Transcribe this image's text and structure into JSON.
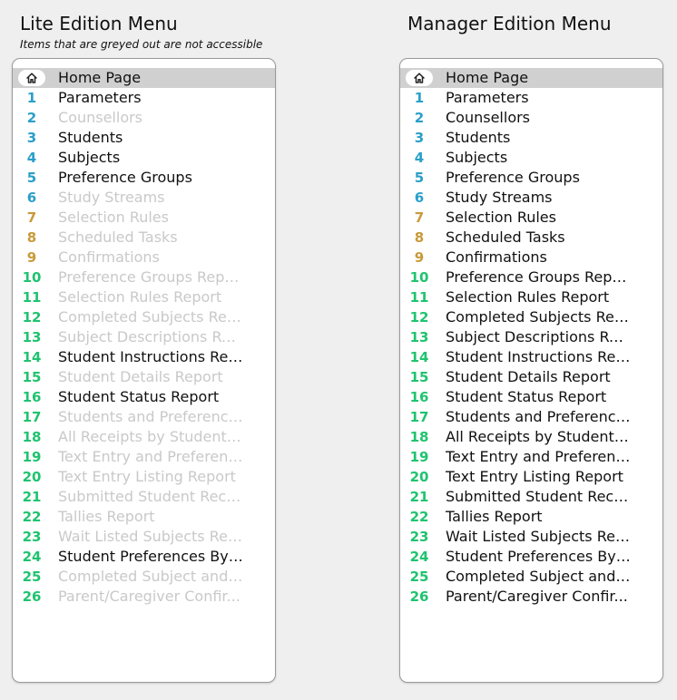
{
  "lite": {
    "title": "Lite Edition Menu",
    "subtitle": "Items that are greyed out are not accessible",
    "home_label": "Home Page",
    "items": [
      {
        "num": "1",
        "label": "Parameters",
        "color": "#2a9fc9",
        "enabled": true
      },
      {
        "num": "2",
        "label": "Counsellors",
        "color": "#2a9fc9",
        "enabled": false
      },
      {
        "num": "3",
        "label": "Students",
        "color": "#2a9fc9",
        "enabled": true
      },
      {
        "num": "4",
        "label": "Subjects",
        "color": "#2a9fc9",
        "enabled": true
      },
      {
        "num": "5",
        "label": "Preference Groups",
        "color": "#2a9fc9",
        "enabled": true
      },
      {
        "num": "6",
        "label": "Study Streams",
        "color": "#2a9fc9",
        "enabled": false
      },
      {
        "num": "7",
        "label": "Selection Rules",
        "color": "#c99a3a",
        "enabled": false
      },
      {
        "num": "8",
        "label": "Scheduled Tasks",
        "color": "#c99a3a",
        "enabled": false
      },
      {
        "num": "9",
        "label": "Confirmations",
        "color": "#c99a3a",
        "enabled": false
      },
      {
        "num": "10",
        "label": "Preference Groups Report",
        "color": "#1fc36f",
        "enabled": false
      },
      {
        "num": "11",
        "label": "Selection Rules Report",
        "color": "#1fc36f",
        "enabled": false
      },
      {
        "num": "12",
        "label": "Completed Subjects Rep...",
        "color": "#1fc36f",
        "enabled": false
      },
      {
        "num": "13",
        "label": "Subject Descriptions Rep...",
        "color": "#1fc36f",
        "enabled": false
      },
      {
        "num": "14",
        "label": "Student Instructions Rep...",
        "color": "#1fc36f",
        "enabled": true
      },
      {
        "num": "15",
        "label": "Student Details Report",
        "color": "#1fc36f",
        "enabled": false
      },
      {
        "num": "16",
        "label": "Student Status Report",
        "color": "#1fc36f",
        "enabled": true
      },
      {
        "num": "17",
        "label": "Students and Preference...",
        "color": "#1fc36f",
        "enabled": false
      },
      {
        "num": "18",
        "label": "All Receipts by Student R...",
        "color": "#1fc36f",
        "enabled": false
      },
      {
        "num": "19",
        "label": "Text Entry and Preferenc...",
        "color": "#1fc36f",
        "enabled": false
      },
      {
        "num": "20",
        "label": "Text Entry Listing Report",
        "color": "#1fc36f",
        "enabled": false
      },
      {
        "num": "21",
        "label": "Submitted Student Recei...",
        "color": "#1fc36f",
        "enabled": false
      },
      {
        "num": "22",
        "label": "Tallies Report",
        "color": "#1fc36f",
        "enabled": false
      },
      {
        "num": "23",
        "label": "Wait Listed Subjects Rep...",
        "color": "#1fc36f",
        "enabled": false
      },
      {
        "num": "24",
        "label": "Student Preferences By S...",
        "color": "#1fc36f",
        "enabled": true
      },
      {
        "num": "25",
        "label": "Completed Subject and P...",
        "color": "#1fc36f",
        "enabled": false
      },
      {
        "num": "26",
        "label": "Parent/Caregiver Confir...",
        "color": "#1fc36f",
        "enabled": false
      }
    ]
  },
  "manager": {
    "title": "Manager Edition Menu",
    "home_label": "Home Page",
    "items": [
      {
        "num": "1",
        "label": "Parameters",
        "color": "#2a9fc9",
        "enabled": true
      },
      {
        "num": "2",
        "label": "Counsellors",
        "color": "#2a9fc9",
        "enabled": true
      },
      {
        "num": "3",
        "label": "Students",
        "color": "#2a9fc9",
        "enabled": true
      },
      {
        "num": "4",
        "label": "Subjects",
        "color": "#2a9fc9",
        "enabled": true
      },
      {
        "num": "5",
        "label": "Preference Groups",
        "color": "#2a9fc9",
        "enabled": true
      },
      {
        "num": "6",
        "label": "Study Streams",
        "color": "#2a9fc9",
        "enabled": true
      },
      {
        "num": "7",
        "label": "Selection Rules",
        "color": "#c99a3a",
        "enabled": true
      },
      {
        "num": "8",
        "label": "Scheduled Tasks",
        "color": "#c99a3a",
        "enabled": true
      },
      {
        "num": "9",
        "label": "Confirmations",
        "color": "#c99a3a",
        "enabled": true
      },
      {
        "num": "10",
        "label": "Preference Groups Report",
        "color": "#1fc36f",
        "enabled": true
      },
      {
        "num": "11",
        "label": "Selection Rules Report",
        "color": "#1fc36f",
        "enabled": true
      },
      {
        "num": "12",
        "label": "Completed Subjects Rep...",
        "color": "#1fc36f",
        "enabled": true
      },
      {
        "num": "13",
        "label": "Subject Descriptions Rep...",
        "color": "#1fc36f",
        "enabled": true
      },
      {
        "num": "14",
        "label": "Student Instructions Rep...",
        "color": "#1fc36f",
        "enabled": true
      },
      {
        "num": "15",
        "label": "Student Details Report",
        "color": "#1fc36f",
        "enabled": true
      },
      {
        "num": "16",
        "label": "Student Status Report",
        "color": "#1fc36f",
        "enabled": true
      },
      {
        "num": "17",
        "label": "Students and Preference...",
        "color": "#1fc36f",
        "enabled": true
      },
      {
        "num": "18",
        "label": "All Receipts by Student R...",
        "color": "#1fc36f",
        "enabled": true
      },
      {
        "num": "19",
        "label": "Text Entry and Preferenc...",
        "color": "#1fc36f",
        "enabled": true
      },
      {
        "num": "20",
        "label": "Text Entry Listing Report",
        "color": "#1fc36f",
        "enabled": true
      },
      {
        "num": "21",
        "label": "Submitted Student Recei...",
        "color": "#1fc36f",
        "enabled": true
      },
      {
        "num": "22",
        "label": "Tallies Report",
        "color": "#1fc36f",
        "enabled": true
      },
      {
        "num": "23",
        "label": "Wait Listed Subjects Rep...",
        "color": "#1fc36f",
        "enabled": true
      },
      {
        "num": "24",
        "label": "Student Preferences By S...",
        "color": "#1fc36f",
        "enabled": true
      },
      {
        "num": "25",
        "label": "Completed Subject and P...",
        "color": "#1fc36f",
        "enabled": true
      },
      {
        "num": "26",
        "label": "Parent/Caregiver Confir...",
        "color": "#1fc36f",
        "enabled": true
      }
    ]
  },
  "icons": {
    "home": "home-icon"
  },
  "colors": {
    "disabled_text": "#c9c9c9",
    "home_highlight": "#d0d0d0"
  }
}
